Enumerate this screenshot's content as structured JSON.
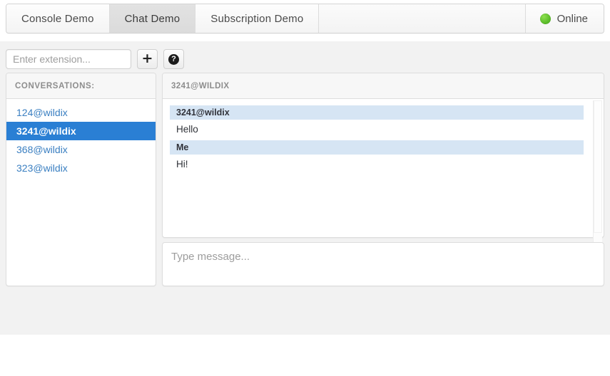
{
  "tabs": [
    {
      "label": "Console Demo",
      "active": false
    },
    {
      "label": "Chat Demo",
      "active": true
    },
    {
      "label": "Subscription Demo",
      "active": false
    }
  ],
  "status": {
    "label": "Online",
    "color": "#5cbd2a",
    "icon": "status-dot-icon"
  },
  "toolbar": {
    "extension_placeholder": "Enter extension...",
    "extension_value": "",
    "add_label": "+",
    "help_label": "?",
    "add_icon": "plus-icon",
    "help_icon": "question-mark-icon"
  },
  "conversations": {
    "title": "CONVERSATIONS:",
    "items": [
      {
        "label": "124@wildix",
        "selected": false
      },
      {
        "label": "3241@wildix",
        "selected": true
      },
      {
        "label": "368@wildix",
        "selected": false
      },
      {
        "label": "323@wildix",
        "selected": false
      }
    ]
  },
  "chat": {
    "header": "3241@WILDIX",
    "messages": [
      {
        "sender": "3241@wildix",
        "text": "Hello"
      },
      {
        "sender": "Me",
        "text": "Hi!"
      }
    ]
  },
  "compose": {
    "placeholder": "Type message...",
    "value": ""
  },
  "colors": {
    "selected_row": "#2a7fd4",
    "link": "#3a7fc1",
    "message_header": "#d6e5f4",
    "online": "#5cbd2a"
  }
}
